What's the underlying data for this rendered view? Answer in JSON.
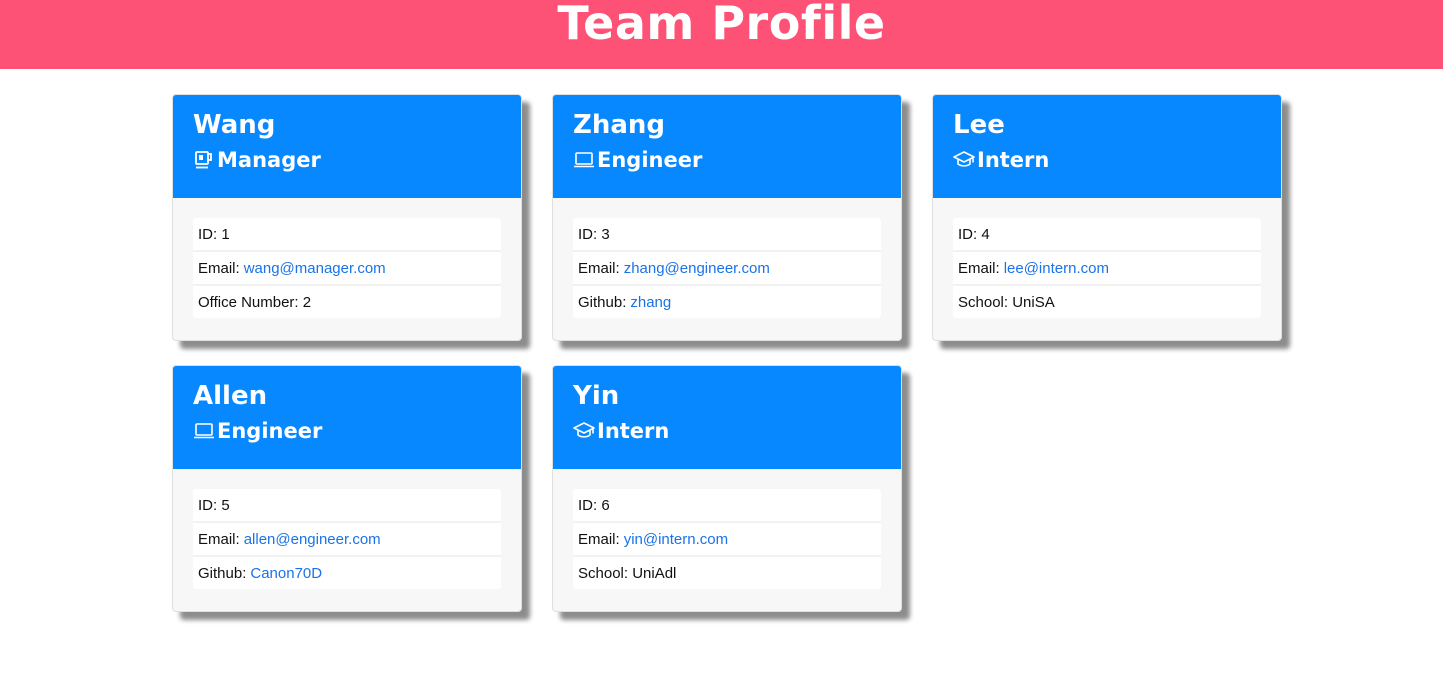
{
  "header": {
    "title": "Team Profile"
  },
  "cards": [
    {
      "name": "Wang",
      "role": "Manager",
      "icon": "coffee-mug-icon",
      "id_text": "ID: 1",
      "email_label": "Email:",
      "email": "wang@manager.com",
      "extra_label": "Office Number: 2",
      "extra_link": ""
    },
    {
      "name": "Zhang",
      "role": "Engineer",
      "icon": "laptop-icon",
      "id_text": "ID: 3",
      "email_label": "Email:",
      "email": "zhang@engineer.com",
      "extra_label": "Github:",
      "extra_link": "zhang"
    },
    {
      "name": "Lee",
      "role": "Intern",
      "icon": "graduation-cap-icon",
      "id_text": "ID: 4",
      "email_label": "Email:",
      "email": "lee@intern.com",
      "extra_label": "School: UniSA",
      "extra_link": ""
    },
    {
      "name": "Allen",
      "role": "Engineer",
      "icon": "laptop-icon",
      "id_text": "ID: 5",
      "email_label": "Email:",
      "email": "allen@engineer.com",
      "extra_label": "Github:",
      "extra_link": "Canon70D"
    },
    {
      "name": "Yin",
      "role": "Intern",
      "icon": "graduation-cap-icon",
      "id_text": "ID: 6",
      "email_label": "Email:",
      "email": "yin@intern.com",
      "extra_label": "School: UniAdl",
      "extra_link": ""
    }
  ],
  "colors": {
    "header_bg": "#fd5175",
    "card_header_bg": "#0788ff",
    "link": "#1a73e8"
  }
}
